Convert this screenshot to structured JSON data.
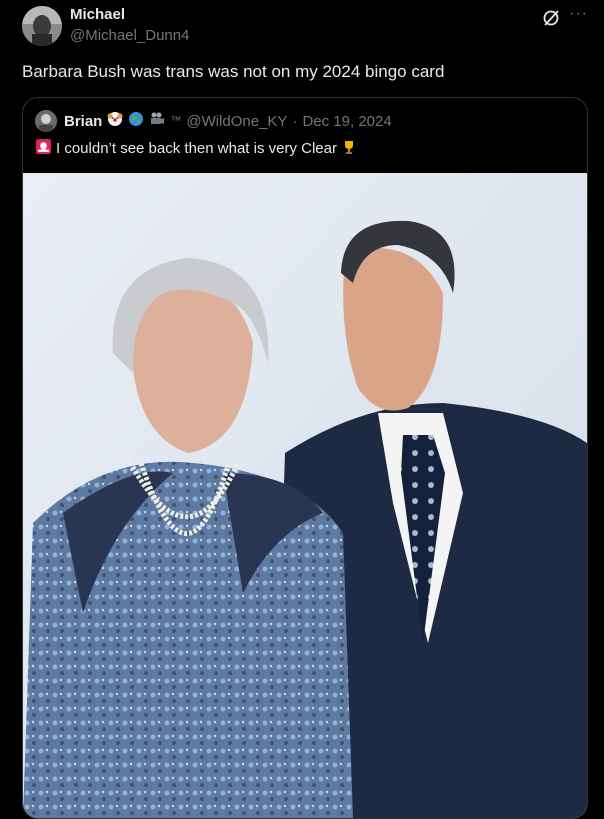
{
  "author": {
    "name": "Michael",
    "handle": "@Michael_Dunn4"
  },
  "post": {
    "text": "Barbara Bush was trans was not on my 2024 bingo card"
  },
  "actions": {
    "grok_icon": "grok-icon",
    "more_label": "···"
  },
  "quoted": {
    "name": "Brian",
    "badges": [
      "clown-face-emoji",
      "globe-emoji",
      "movie-camera-emoji"
    ],
    "tm_label": "™",
    "handle": "@WildOne_KY",
    "separator": "·",
    "date": "Dec 19, 2024",
    "text": "I couldn’t see back then what is very Clear",
    "text_icons": [
      "siren-emoji",
      "trophy-emoji"
    ]
  },
  "colors": {
    "background": "#000000",
    "text_primary": "#e7e9ea",
    "text_secondary": "#71767b",
    "border": "#2f3336"
  }
}
